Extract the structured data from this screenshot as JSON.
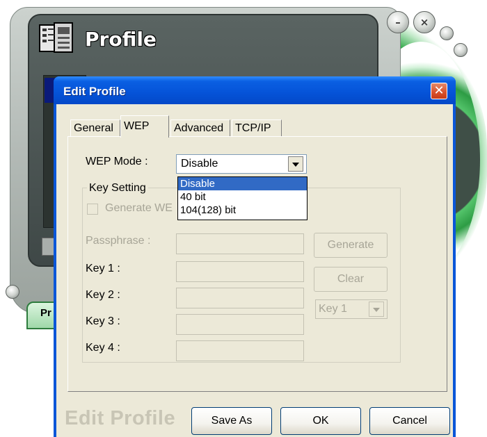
{
  "background_app": {
    "title": "Profile",
    "tab_label": "Pr",
    "buttons": [
      "minimize",
      "close"
    ]
  },
  "dialog": {
    "title": "Edit Profile",
    "close_glyph": "✕",
    "tabs": [
      {
        "label": "General",
        "active": false
      },
      {
        "label": "WEP",
        "active": true
      },
      {
        "label": "Advanced",
        "active": false
      },
      {
        "label": "TCP/IP",
        "active": false
      }
    ],
    "wep": {
      "mode_label": "WEP Mode :",
      "mode_value": "Disable",
      "mode_options": [
        "Disable",
        "40 bit",
        "104(128) bit"
      ],
      "mode_selected_index": 0,
      "key_setting_label": "Key Setting",
      "generate_wep_label": "Generate WE",
      "passphrase_label": "Passphrase :",
      "generate_button": "Generate",
      "clear_button": "Clear",
      "key_labels": [
        "Key 1 :",
        "Key 2 :",
        "Key 3 :",
        "Key 4 :"
      ],
      "key_select_value": "Key 1"
    },
    "footer": {
      "brand": "Edit Profile",
      "save_as": "Save As",
      "ok": "OK",
      "cancel": "Cancel"
    }
  },
  "colors": {
    "titlebar": "#0553d8",
    "selection": "#316ac5",
    "dialog_bg": "#ece9d8",
    "ring_green": "#2ca744"
  }
}
